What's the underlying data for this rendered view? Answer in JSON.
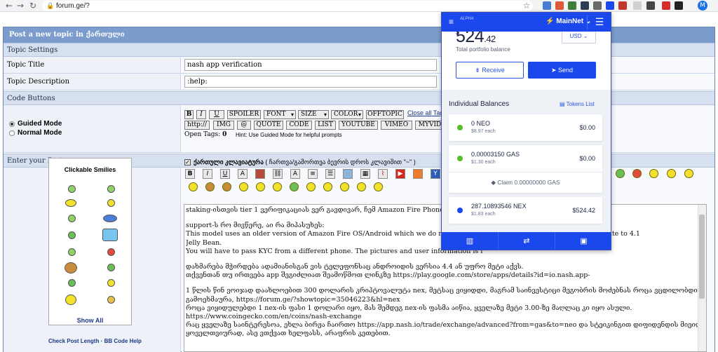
{
  "browser": {
    "url": "forum.ge/?",
    "profile_initial": "M"
  },
  "form": {
    "title": "Post a new topic in ქართული",
    "settings_header": "Topic Settings",
    "topic_title_label": "Topic Title",
    "topic_title_value": "nash app verification",
    "topic_desc_label": "Topic Description",
    "topic_desc_value": ":help:",
    "code_buttons_header": "Code Buttons",
    "mode_guided": "Guided Mode",
    "mode_normal": "Normal Mode",
    "enter_post_header": "Enter your Post",
    "buttons_row1": [
      "B",
      "I",
      "U",
      "SPOILER",
      "FONT",
      "SIZE",
      "COLOR",
      "OFFTOPIC"
    ],
    "close_all_tags": "Close all Tags",
    "buttons_row2": [
      "http://",
      "IMG",
      "@",
      "QUOTE",
      "CODE",
      "LIST",
      "YOUTUBE",
      "VIMEO",
      "MYVID"
    ],
    "open_tags_label": "Open Tags:",
    "open_tags_count": "0",
    "hint": "Hint: Use Guided Mode for helpful prompts",
    "georgian_checkbox_label": "ქართული კლავიატურა",
    "georgian_checkbox_note": "( ჩართვა/გამორთვა ბევრის დროს კლავიშით \"~\" )",
    "smilies_title": "Clickable Smilies",
    "show_all": "Show All",
    "check_length": "Check Post Length · BB Code Help"
  },
  "post_lines": [
    "staking-ისთვის tier 1 ვერიფიკაციას ვერ გავდივარ, ჩემ Amazon Fire Phone SD4930U",
    "",
    "support-ს რო მივწერე, აი რა მიპასუხეს:",
    "This model uses an older version of Amazon Fire OS/Android which we do not support. The Amazon Fire Phone can only update to 4.1",
    "Jelly Bean.",
    "You will have to pass KYC from a different phone. The pictures and user information is r",
    "",
    "დახმარება მჭირდება ადამიანისგან ვის ტელეფონსაც ანდროიდის ვერსია 4.4 ან უფრო მეტი აქვს.",
    "თქვენთან თუ ირთვება app შეგიძლიათ შეამოწმოთ ლინკზე https://play.google.com/store/apps/details?id=io.nash.app-",
    "",
    "1 წლის წინ ვოიჯად დაახლოებით 300 დოლარის კრიპტოვალუტა nex, მეტსაც ვიყიდდი, მაგრამ საინვესტიცი მეგობრის მოძებნას როცა ვცდილობდი არავინ",
    "გამოეხმაურა, https://forum.ge/?showtopic=35046223&hl=nex",
    "როცა ვიყიდულებდი 1 nex-ის ფასი 1 დოლარი იყო, მას შემდეგ  nex-ის ფასმა აიწია, ყველაზე მეტი 3.00-ზე მაღლაც კი იყო ასული.",
    "https://www.coingecko.com/en/coins/nash-exchange",
    "რაც ყველაზე საინტერესოა, ეხლა ბირჟა ჩაირთო https://app.nash.io/trade/exchange/advanced?from=gas&to=neo და სტეიკინგით დიფიდენდის მიეიღებ",
    "ყოველთვიურად, ასე ვთქვათ ხელფასს, არაფრის კეთებით."
  ],
  "wallet": {
    "alpha_label": "ALPHA",
    "network": "MainNet",
    "balance_whole": "524",
    "balance_decimal": ".42",
    "balance_currency_symbol": "$",
    "balance_caption": "Total portfolio balance",
    "currency_select": "USD",
    "receive_label": "Receive",
    "send_label": "Send",
    "individual_balances": "Individual Balances",
    "tokens_list": "Tokens List",
    "tokens": [
      {
        "name": "0 NEO",
        "price": "$8.97 each",
        "value": "$0.00",
        "color": "#58be23"
      },
      {
        "name": "0.00003150 GAS",
        "price": "$1.30 each",
        "value": "$0.00",
        "color": "#58be23"
      },
      {
        "name": "287.10893546 NEX",
        "price": "$1.83 each",
        "value": "$524.42",
        "color": "#1a48ec"
      }
    ],
    "claim_label": "Claim 0.00000000 GAS",
    "accent": "#1a48ec"
  }
}
